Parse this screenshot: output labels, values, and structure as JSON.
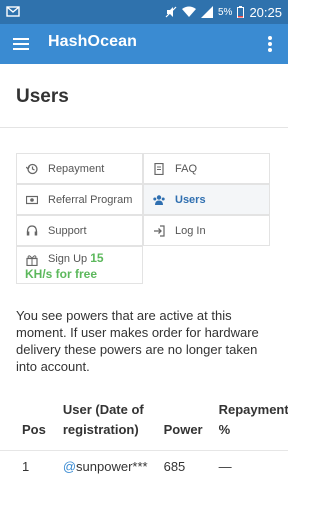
{
  "status_bar": {
    "time": "20:25",
    "battery_percent": "5%",
    "icons": [
      "mail-notification-icon",
      "mute-icon",
      "wifi-icon",
      "signal-icon",
      "battery-icon"
    ]
  },
  "app_bar": {
    "title": "HashOcean",
    "background": "#3a8bd2"
  },
  "page": {
    "title": "Users"
  },
  "nav": {
    "repayment": "Repayment",
    "faq": "FAQ",
    "referral": "Referral Program",
    "users": "Users",
    "support": "Support",
    "login": "Log In",
    "signup_prefix": "Sign Up",
    "signup_highlight_a": "15",
    "signup_highlight_b": "KH/s for free",
    "highlight_color": "#5cb85c",
    "active_color": "#2f6fb0"
  },
  "info_text": "You see powers that are active at this moment. If user makes order for hardware delivery these powers are no longer taken into account.",
  "table": {
    "headers": {
      "pos": "Pos",
      "user": "User (Date of registration)",
      "power": "Power",
      "repay": "Repayment %"
    },
    "rows": [
      {
        "pos": "1",
        "at": "@",
        "user": "sunpower***",
        "power": "685",
        "repay": "—"
      }
    ]
  }
}
